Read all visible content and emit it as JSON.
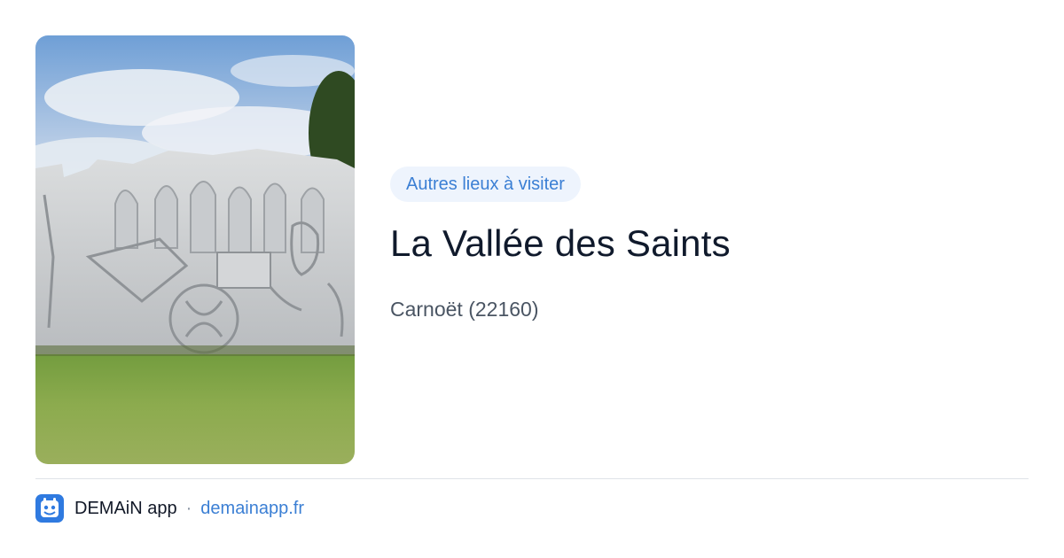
{
  "badge": {
    "label": "Autres lieux à visiter"
  },
  "place": {
    "title": "La Vallée des Saints",
    "location": "Carnoët (22160)"
  },
  "photo": {
    "alt": "Sculpture de granit à la Vallée des Saints"
  },
  "footer": {
    "app_name": "DEMAiN app",
    "separator": "·",
    "site": "demainapp.fr"
  },
  "colors": {
    "accent": "#3b7fd4",
    "badge_bg": "#eef4fd",
    "title": "#101a2c",
    "muted": "#4a5563"
  }
}
